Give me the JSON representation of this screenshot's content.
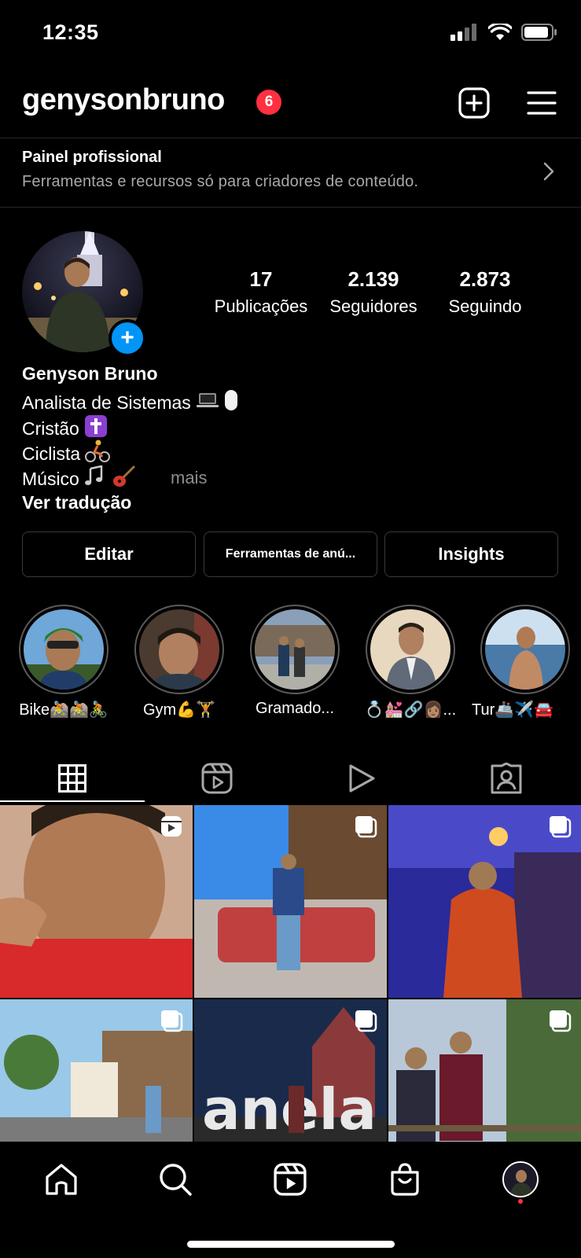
{
  "status_bar": {
    "time": "12:35"
  },
  "header": {
    "username": "genysonbruno",
    "notification_count": "6"
  },
  "professional_panel": {
    "title": "Painel profissional",
    "subtitle": "Ferramentas e recursos só para criadores de conteúdo."
  },
  "stats": [
    {
      "value": "17",
      "label": "Publicações"
    },
    {
      "value": "2.139",
      "label": "Seguidores"
    },
    {
      "value": "2.873",
      "label": "Seguindo"
    }
  ],
  "bio": {
    "name": "Genyson Bruno",
    "lines": [
      "Analista de Sistemas",
      "Cristão",
      "Ciclista",
      "Músico"
    ],
    "more": "mais",
    "translate": "Ver tradução"
  },
  "actions": {
    "edit": "Editar",
    "ad_tools": "Ferramentas de anú...",
    "insights": "Insights"
  },
  "highlights": [
    {
      "label": "Bike🚵🚵🚴"
    },
    {
      "label": "Gym💪🏋️"
    },
    {
      "label": "Gramado..."
    },
    {
      "label": "💍💒🔗👩🏽..."
    },
    {
      "label": "Tur🚢✈️🚘"
    }
  ],
  "colors": {
    "accent": "#0095f6",
    "badge": "#ff3040",
    "background": "#000000"
  }
}
